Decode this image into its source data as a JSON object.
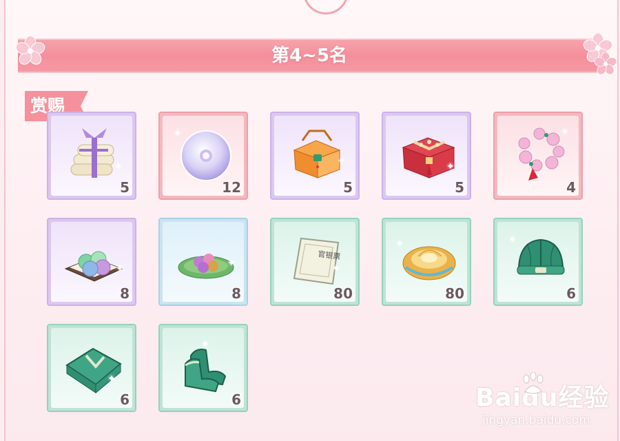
{
  "header": {
    "title": "第4~5名"
  },
  "section": {
    "label": "赏赐"
  },
  "items": [
    {
      "name": "silk-scroll-bundle",
      "count": "5"
    },
    {
      "name": "jade-disc",
      "count": "12"
    },
    {
      "name": "orange-chest",
      "count": "5"
    },
    {
      "name": "red-chest",
      "count": "5"
    },
    {
      "name": "pink-bracelet",
      "count": "4"
    },
    {
      "name": "dumpling-plate",
      "count": "8"
    },
    {
      "name": "lotus-leaf-pearls",
      "count": "8"
    },
    {
      "name": "silver-note",
      "count": "80"
    },
    {
      "name": "gold-ingot",
      "count": "80"
    },
    {
      "name": "green-cap",
      "count": "6"
    },
    {
      "name": "green-robe",
      "count": "6"
    },
    {
      "name": "green-boots",
      "count": "6"
    }
  ],
  "note_text": {
    "silver_note": "官银票"
  },
  "watermark": {
    "main": "Baidu经验",
    "sub": "jingyan.baidu.com"
  }
}
